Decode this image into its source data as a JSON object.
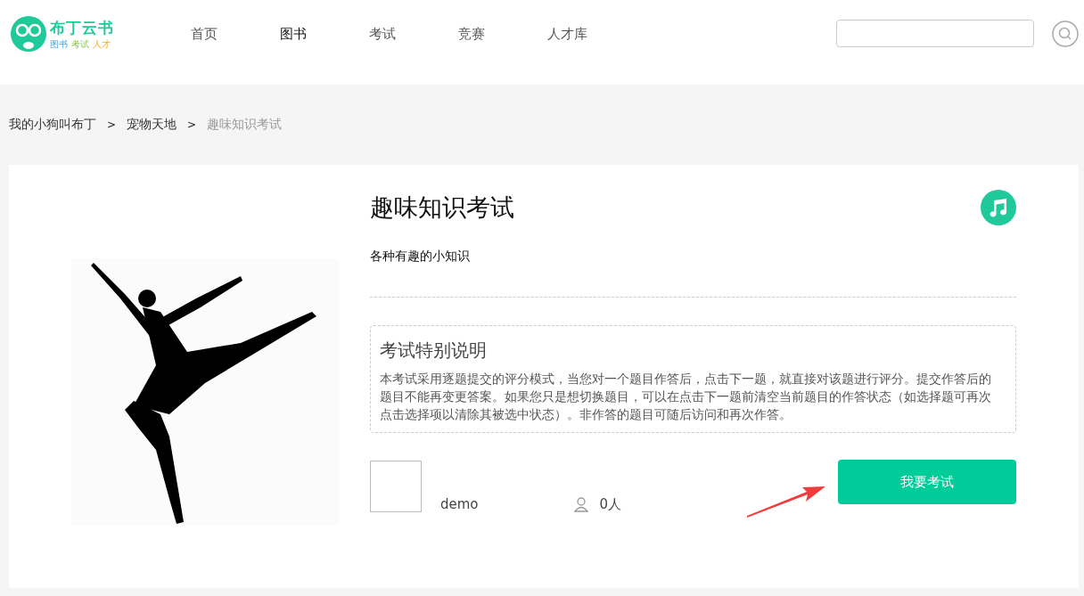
{
  "logo": {
    "name": "布丁云书",
    "tags": [
      "图书",
      "考试",
      "人才"
    ]
  },
  "nav": [
    {
      "label": "首页",
      "selected": false
    },
    {
      "label": "图书",
      "selected": true
    },
    {
      "label": "考试",
      "selected": false
    },
    {
      "label": "竞赛",
      "selected": false
    },
    {
      "label": "人才库",
      "selected": false
    }
  ],
  "breadcrumb": [
    {
      "label": "我的小狗叫布丁",
      "separator": ">"
    },
    {
      "label": "宠物天地",
      "separator": ">"
    },
    {
      "label": "趣味知识考试"
    }
  ],
  "exam": {
    "title": "趣味知识考试",
    "subtitle": "各种有趣的小知识",
    "notice_title": "考试特别说明",
    "notice_text": "本考试采用逐题提交的评分模式，当您对一个题目作答后，点击下一题，就直接对该题进行评分。提交作答后的题目不能再变更答案。如果您只是想切换题目，可以在点击下一题前清空当前题目的作答状态（如选择题可再次点击选择项以清除其被选中状态）。非作答的题目可随后访问和再次作答。",
    "author": "demo",
    "participants": "0人",
    "button": "我要考试"
  }
}
